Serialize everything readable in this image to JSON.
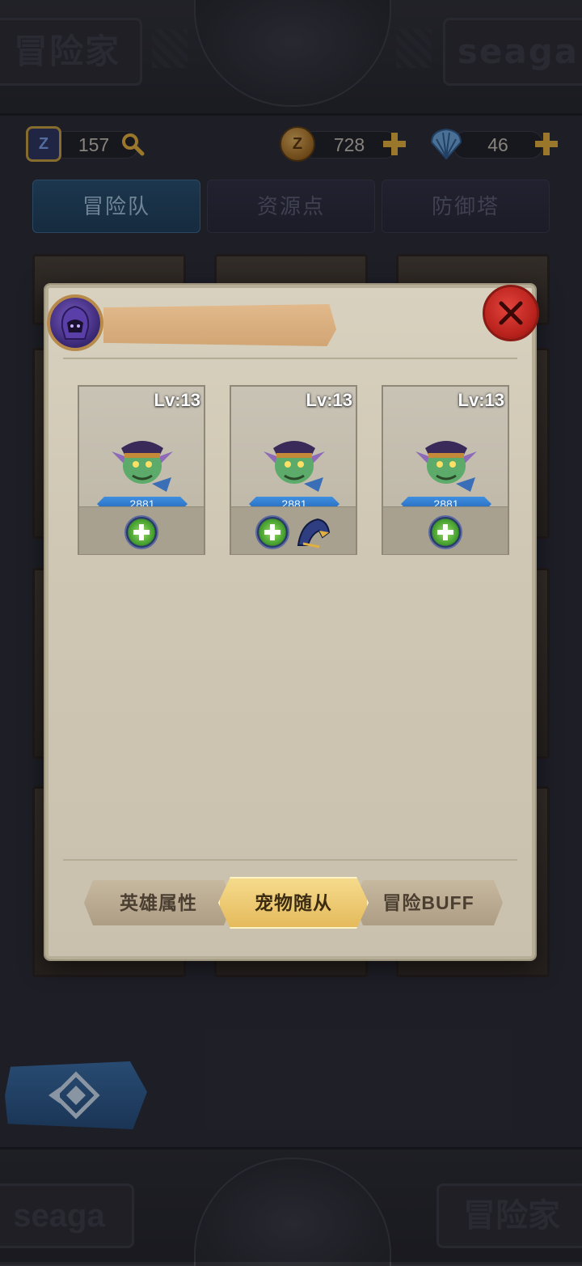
{
  "header": {
    "left_plate_text": "冒险家",
    "right_plate_text": "seaga"
  },
  "footer": {
    "left_plate_text": "seaga",
    "right_plate_text": "冒险家"
  },
  "resources": {
    "badge": {
      "value": "157",
      "icon": "z-badge-icon",
      "button_icon": "search-icon"
    },
    "coin": {
      "value": "728",
      "icon": "coin-icon",
      "button_icon": "plus-icon"
    },
    "shell": {
      "value": "46",
      "icon": "shell-icon",
      "button_icon": "plus-icon"
    }
  },
  "tabs": [
    {
      "label": "冒险队",
      "active": true
    },
    {
      "label": "资源点",
      "active": false
    },
    {
      "label": "防御塔",
      "active": false
    }
  ],
  "modal": {
    "title": "",
    "close_icon": "close-icon",
    "pets": [
      {
        "level": "Lv:13",
        "power": "2881",
        "skills": 1,
        "has_equip": false
      },
      {
        "level": "Lv:13",
        "power": "2881",
        "skills": 1,
        "has_equip": true
      },
      {
        "level": "Lv:13",
        "power": "2881",
        "skills": 1,
        "has_equip": false
      }
    ],
    "bottom_tabs": [
      {
        "label": "英雄属性",
        "active": false
      },
      {
        "label": "宠物随从",
        "active": true
      },
      {
        "label": "冒险BUFF",
        "active": false
      }
    ]
  },
  "colors": {
    "accent_gold": "#e4b95a",
    "close_red": "#b8211c",
    "power_blue": "#2566b8"
  }
}
